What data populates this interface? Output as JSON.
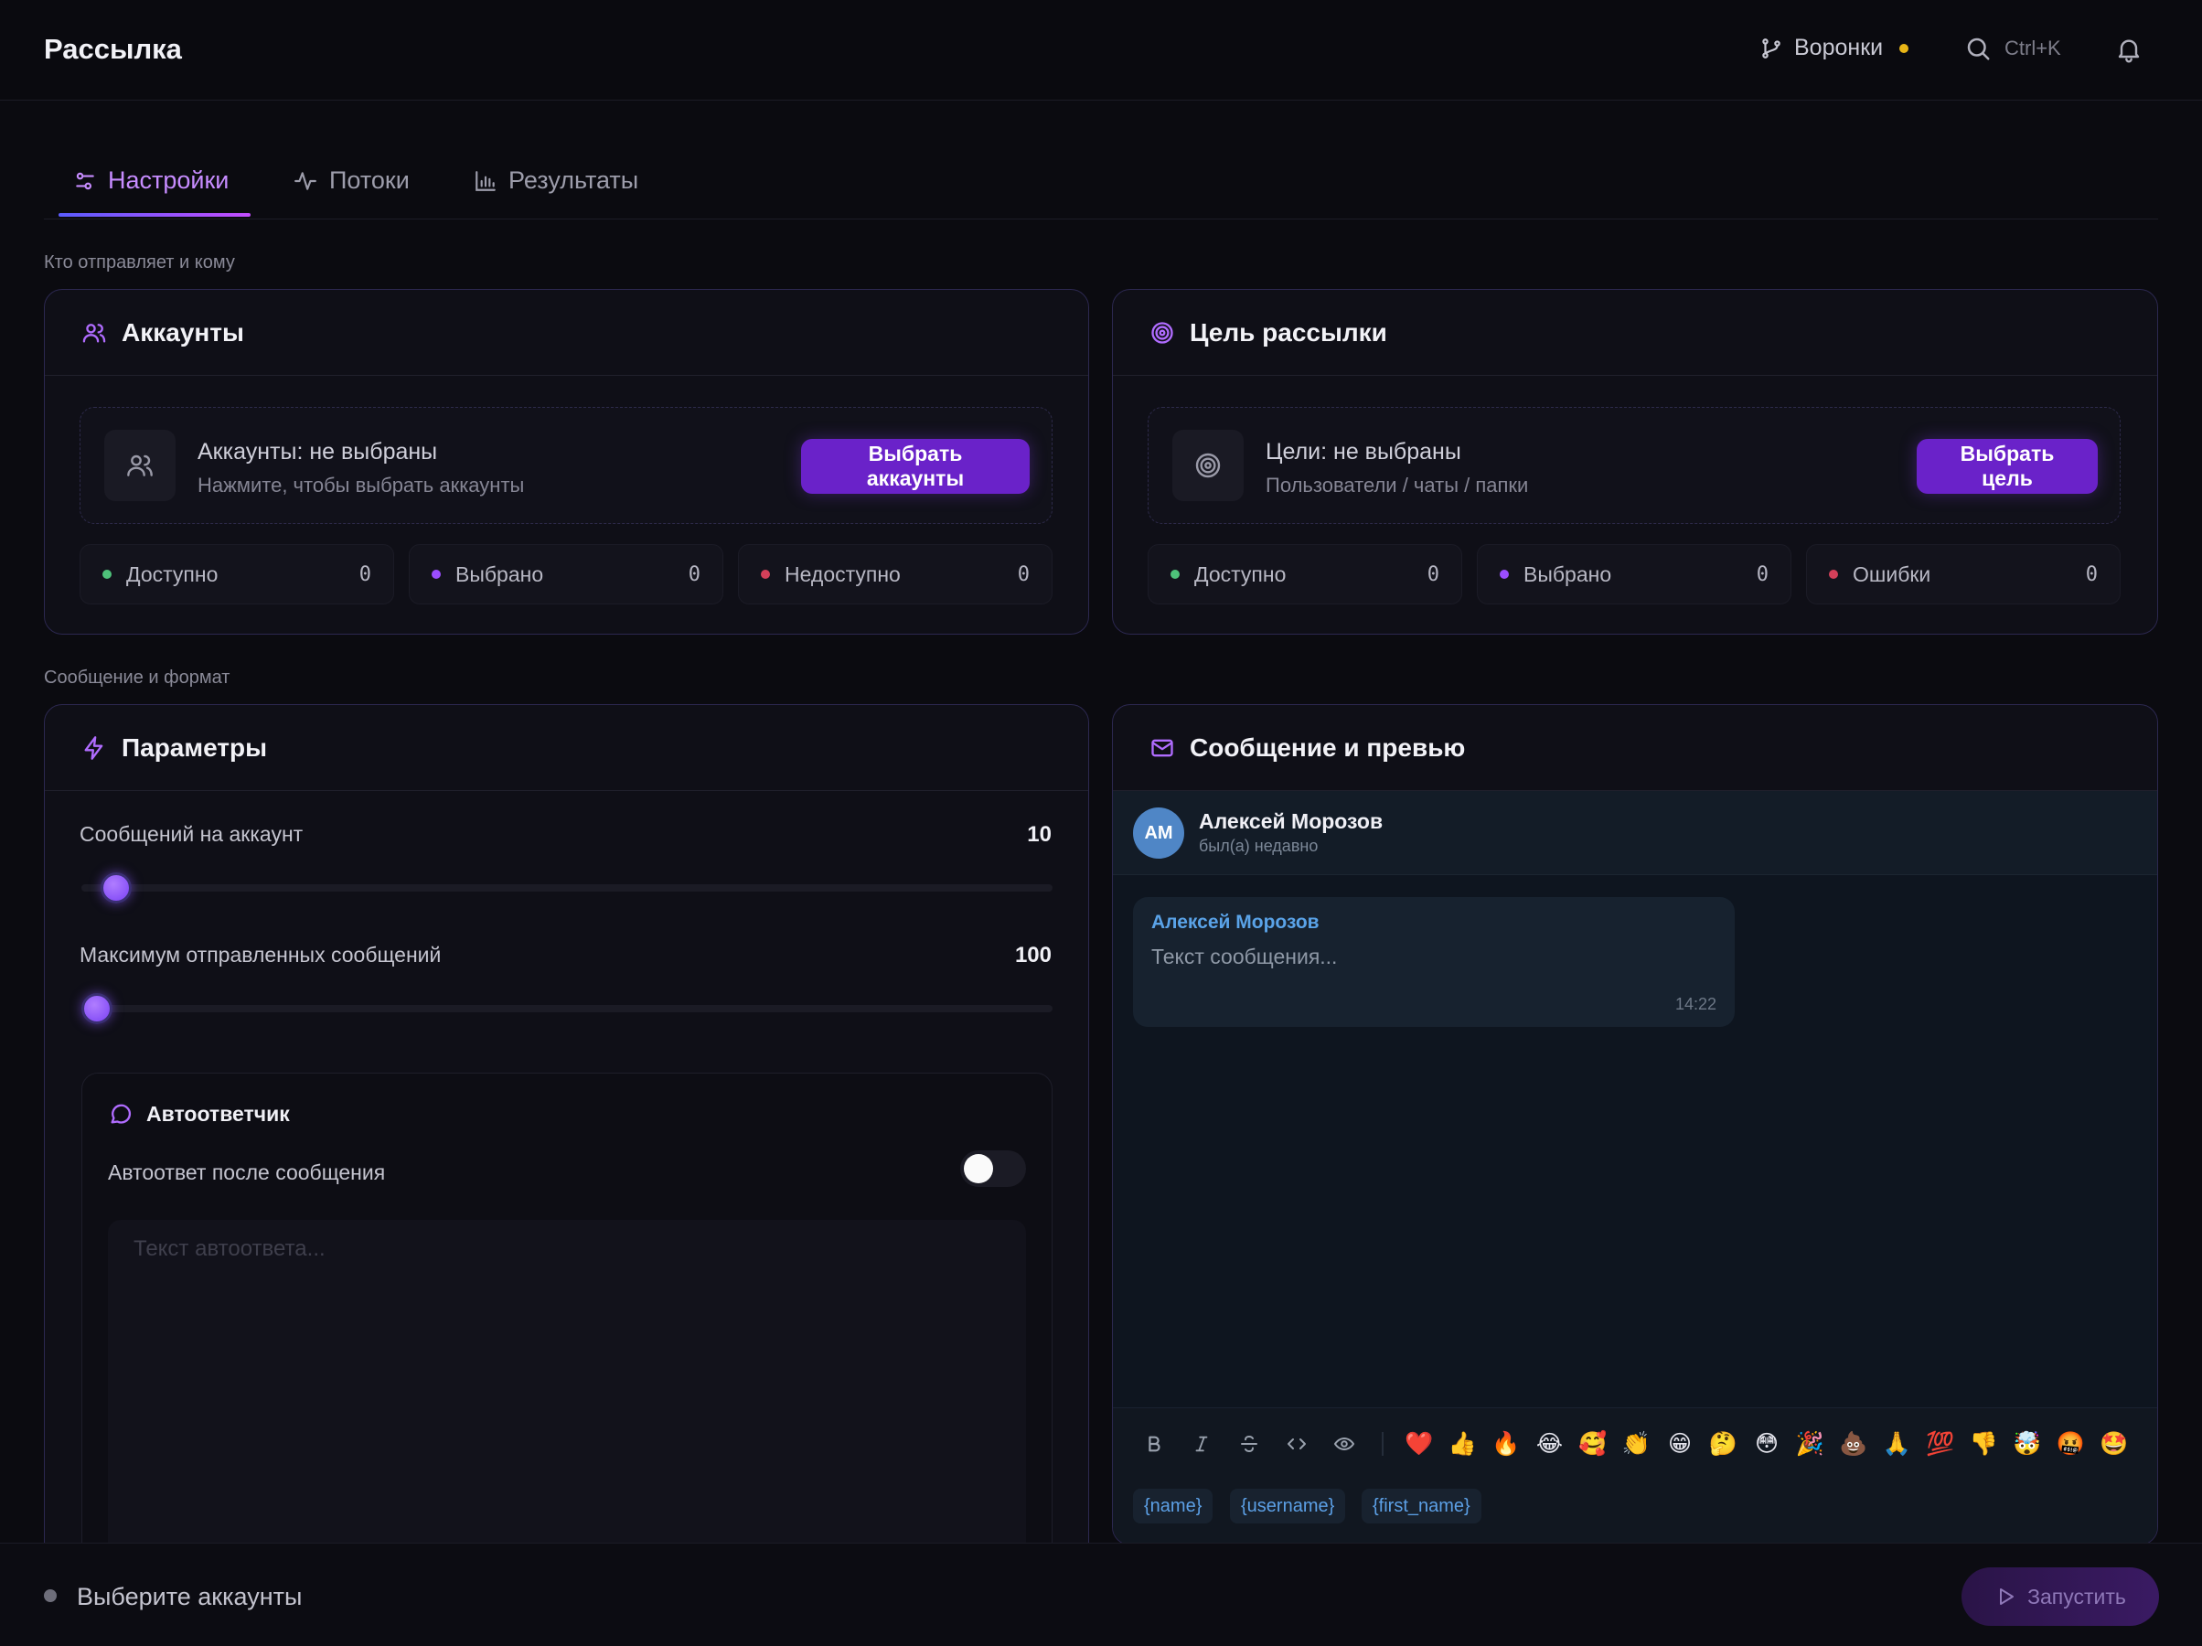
{
  "app": {
    "title": "Рассылка"
  },
  "header": {
    "funnels_label": "Воронки",
    "search_shortcut": "Ctrl+K"
  },
  "tabs": [
    {
      "label": "Настройки",
      "icon": "sliders-icon",
      "active": true
    },
    {
      "label": "Потоки",
      "icon": "activity-icon",
      "active": false
    },
    {
      "label": "Результаты",
      "icon": "bar-chart-icon",
      "active": false
    }
  ],
  "sections": {
    "who": "Кто отправляет и кому",
    "message": "Сообщение и формат"
  },
  "accounts": {
    "title": "Аккаунты",
    "select_title": "Аккаунты: не выбраны",
    "select_subtitle": "Нажмите, чтобы выбрать аккаунты",
    "button": "Выбрать аккаунты",
    "stats": [
      {
        "label": "Доступно",
        "value": "0",
        "color": "#4ec27a"
      },
      {
        "label": "Выбрано",
        "value": "0",
        "color": "#9b4dff"
      },
      {
        "label": "Недоступно",
        "value": "0",
        "color": "#d4405a"
      }
    ]
  },
  "target": {
    "title": "Цель рассылки",
    "select_title": "Цели: не выбраны",
    "select_subtitle": "Пользователи / чаты / папки",
    "button": "Выбрать цель",
    "stats": [
      {
        "label": "Доступно",
        "value": "0",
        "color": "#4ec27a"
      },
      {
        "label": "Выбрано",
        "value": "0",
        "color": "#9b4dff"
      },
      {
        "label": "Ошибки",
        "value": "0",
        "color": "#d4405a"
      }
    ]
  },
  "params": {
    "title": "Параметры",
    "per_account_label": "Сообщений на аккаунт",
    "per_account_value": "10",
    "per_account_fraction": 0.02,
    "max_sent_label": "Максимум отправленных сообщений",
    "max_sent_value": "100",
    "max_sent_fraction": 0.0
  },
  "autoresponder": {
    "title": "Автоответчик",
    "toggle_label": "Автоответ после сообщения",
    "enabled": false,
    "placeholder": "Текст автоответа..."
  },
  "preview": {
    "title": "Сообщение и превью",
    "avatar_initials": "АМ",
    "contact_name": "Алексей Морозов",
    "contact_status": "был(а) недавно",
    "bubble_sender": "Алексей Морозов",
    "bubble_text": "Текст сообщения...",
    "bubble_time": "14:22"
  },
  "formatting": [
    {
      "name": "bold-icon"
    },
    {
      "name": "italic-icon"
    },
    {
      "name": "strikethrough-icon"
    },
    {
      "name": "code-icon"
    },
    {
      "name": "spoiler-eye-icon"
    }
  ],
  "emojis": [
    "❤️",
    "👍",
    "🔥",
    "😂",
    "🥰",
    "👏",
    "😁",
    "🤔",
    "😳",
    "🎉",
    "💩",
    "🙏",
    "💯",
    "👎",
    "🤯",
    "🤬",
    "🤩"
  ],
  "variables": [
    "{name}",
    "{username}",
    "{first_name}"
  ],
  "footer": {
    "status": "Выберите аккаунты",
    "run_button": "Запустить"
  },
  "colors": {
    "accent": "#6a22c9",
    "accent_light": "#c78cff",
    "warning_dot": "#e8b516"
  }
}
